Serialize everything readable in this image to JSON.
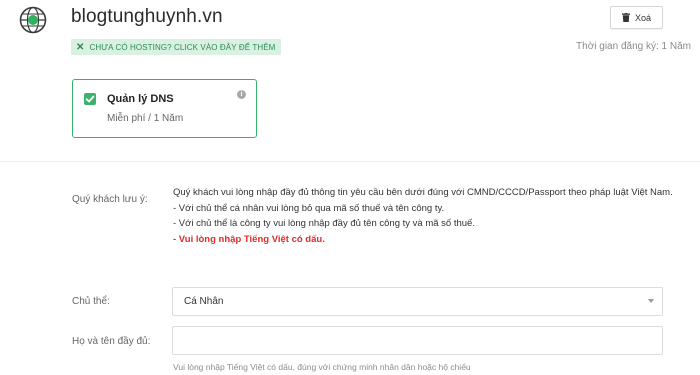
{
  "domain": {
    "name": "blogtunghuynh.vn",
    "icon": "globe-icon"
  },
  "actions": {
    "delete_label": "Xoá",
    "delete_icon": "trash-icon"
  },
  "hosting_badge": {
    "icon": "close-icon",
    "text": "CHƯA CÓ HOSTING? CLICK VÀO ĐÂY ĐỂ THÊM"
  },
  "registration": {
    "text": "Thời gian đăng ký: 1 Năm"
  },
  "dns_card": {
    "title": "Quản lý DNS",
    "subtitle": "Miễn phí / 1 Năm",
    "checked": true,
    "info_icon": "info-icon"
  },
  "form": {
    "notice_label": "Quý khách lưu ý:",
    "notice_lines": [
      "Quý khách vui lòng nhập đầy đủ thông tin yêu cầu bên dưới đúng với CMND/CCCD/Passport theo pháp luật Việt Nam.",
      "- Với chủ thể cá nhân vui lòng bỏ qua mã số thuế và tên công ty.",
      "- Với chủ thể là công ty vui lòng nhập đầy đủ tên công ty và mã số thuế."
    ],
    "notice_warning": "- Vui lòng nhập Tiếng Việt có dấu.",
    "subject_label": "Chủ thể:",
    "subject_value": "Cá Nhân",
    "fullname_label": "Họ và tên đầy đủ:",
    "fullname_value": "",
    "fullname_hint": "Vui lòng nhập Tiếng Việt có dấu, đúng với chứng minh nhân dân hoặc hộ chiếu"
  },
  "colors": {
    "accent_green": "#34b36c",
    "badge_bg": "#d9f1e3",
    "warning_red": "#e22b2b"
  }
}
